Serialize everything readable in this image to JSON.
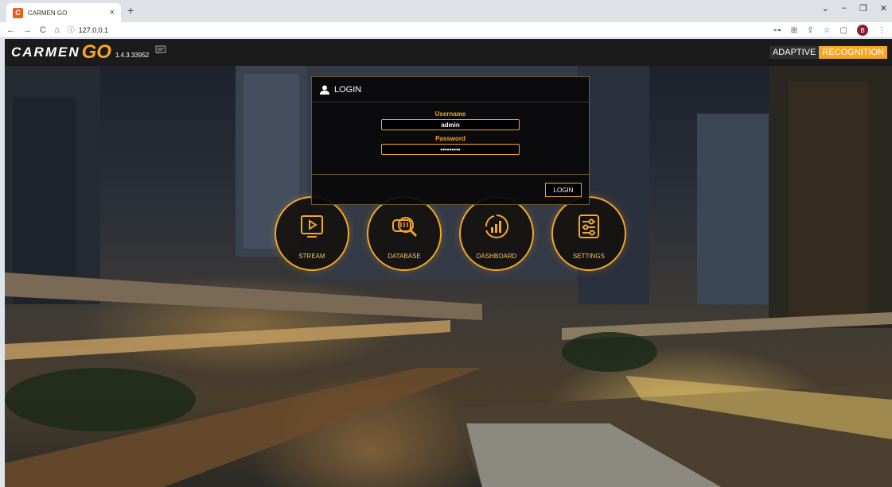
{
  "browser": {
    "tab_title": "CARMEN GO",
    "tab_close": "×",
    "new_tab": "+",
    "url": "127.0.0.1",
    "window_controls": [
      "⌄",
      "–",
      "❐",
      "✕"
    ],
    "profile_initial": "B",
    "icons": [
      "back-arrow-icon",
      "forward-arrow-icon",
      "reload-icon",
      "home-icon",
      "info-icon",
      "key-icon",
      "translate-icon",
      "share-icon",
      "star-icon",
      "sidebar-icon",
      "menu-dots-icon"
    ]
  },
  "app": {
    "logo_text": "CARMEN",
    "logo_go": "GO",
    "version": "1.4.3.33952",
    "brand_part1": "ADAPTIVE",
    "brand_part2": "RECOGNITION",
    "accent_color": "#f5a623"
  },
  "login": {
    "title": "LOGIN",
    "username_label": "Username",
    "username_value": "admin",
    "password_label": "Password",
    "password_value": "•••••••••",
    "submit_label": "LOGIN"
  },
  "menu": {
    "items": [
      {
        "label": "STREAM",
        "icon": "play-screen-icon"
      },
      {
        "label": "DATABASE",
        "icon": "database-search-icon"
      },
      {
        "label": "DASHBOARD",
        "icon": "chart-gauge-icon"
      },
      {
        "label": "SETTINGS",
        "icon": "sliders-icon"
      }
    ]
  }
}
